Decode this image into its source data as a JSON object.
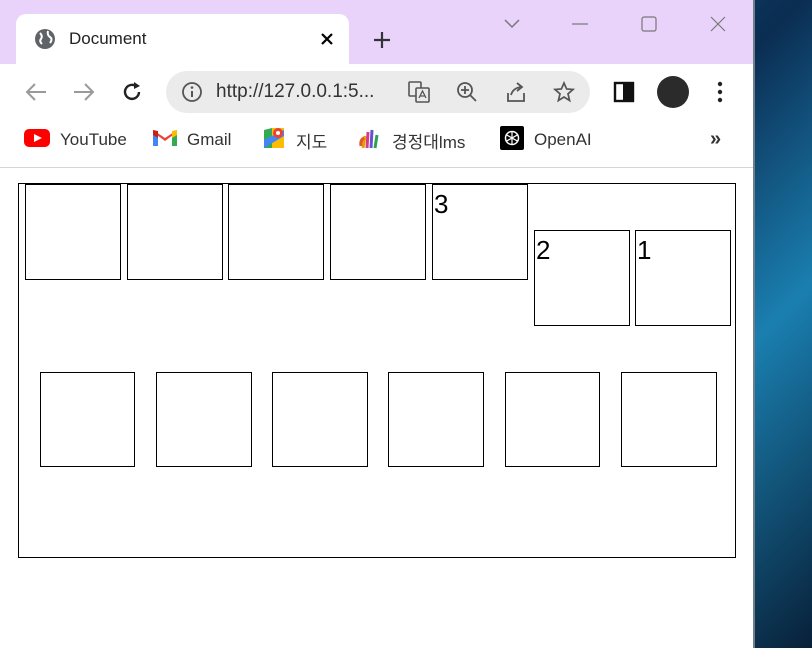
{
  "browser": {
    "tab": {
      "title": "Document"
    },
    "address": {
      "url": "http://127.0.0.1:5..."
    },
    "bookmarks": [
      {
        "label": "YouTube",
        "icon": "youtube-icon"
      },
      {
        "label": "Gmail",
        "icon": "gmail-icon"
      },
      {
        "label": "지도",
        "icon": "maps-icon"
      },
      {
        "label": "경정대lms",
        "icon": "lms-icon"
      },
      {
        "label": "OpenAI",
        "icon": "openai-icon"
      }
    ],
    "bookmarks_more": "»"
  },
  "page": {
    "top_row_boxes": [
      "",
      "",
      "",
      "",
      "3",
      "2",
      "1"
    ],
    "bottom_row_boxes": [
      "",
      "",
      "",
      "",
      "",
      ""
    ]
  },
  "colors": {
    "titlebar": "#e9d3fb",
    "youtube": "#ff0000"
  }
}
